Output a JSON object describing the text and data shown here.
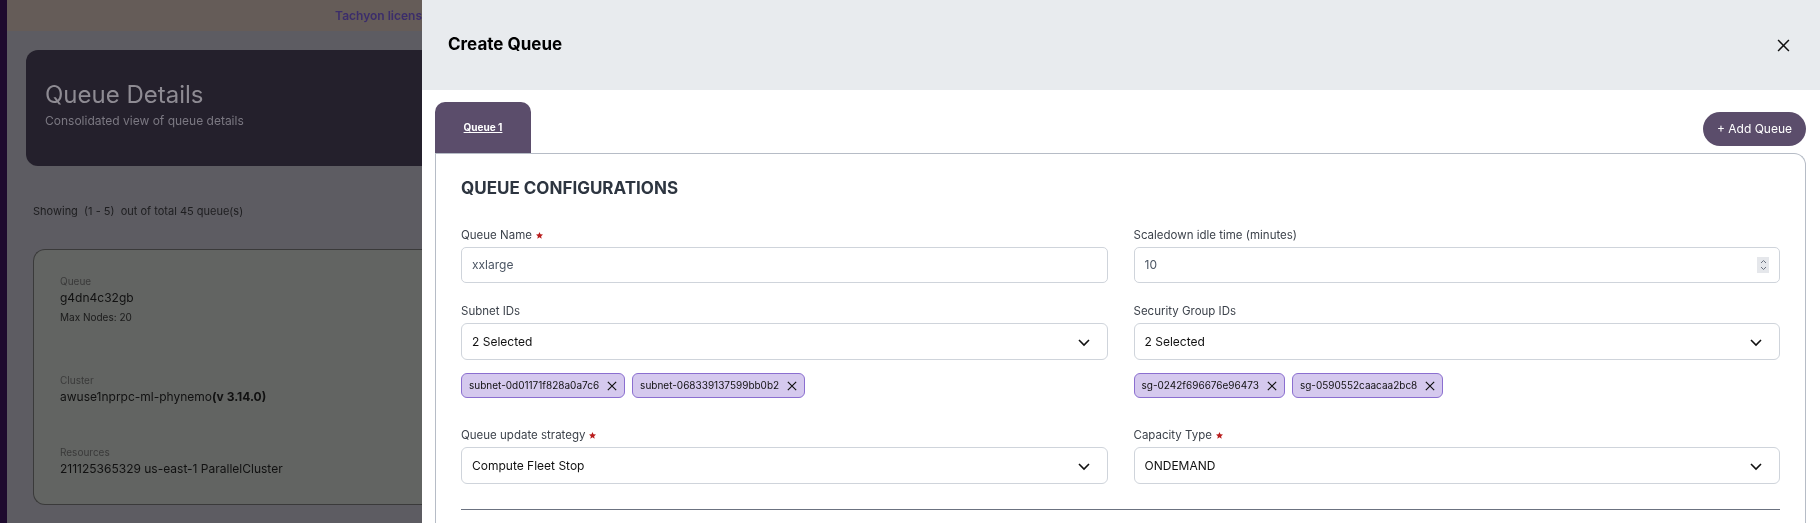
{
  "background_page": {
    "banner": "Tachyon licens",
    "header": {
      "title": "Queue Details",
      "subtitle": "Consolidated view of queue details"
    },
    "showing": "Showing  (1 - 5)  out of total 45 queue(s)",
    "queue_card": [
      {
        "label": "Queue",
        "value": "g4dn4c32gb",
        "note": "Max Nodes: 20"
      },
      {
        "label": "Cluster",
        "value": "awuse1nprpc-ml-phynemo**(v 3.14.0)**"
      },
      {
        "label": "Resources",
        "value": "211125365329 us-east-1 ParallelCluster"
      }
    ]
  },
  "drawer": {
    "title": "Create Queue",
    "tabs": [
      {
        "label": "Queue 1",
        "selected": true
      }
    ],
    "add_button": "+ Add Queue",
    "section_title": "QUEUE CONFIGURATIONS",
    "fields": [
      {
        "kind": "text",
        "label": "Queue Name",
        "required": true,
        "value": "xxlarge"
      },
      {
        "kind": "number",
        "label": "Scaledown idle time (minutes)",
        "required": false,
        "value": "10"
      },
      {
        "kind": "multiselect",
        "label": "Subnet IDs",
        "required": false,
        "value": "2 Selected",
        "chips": [
          "subnet-0d01171f828a0a7c6",
          "subnet-068339137599bb0b2"
        ]
      },
      {
        "kind": "multiselect",
        "label": "Security Group IDs",
        "required": false,
        "value": "2 Selected",
        "chips": [
          "sg-0242f696676e96473",
          "sg-0590552caacaa2bc8"
        ]
      },
      {
        "kind": "select",
        "label": "Queue update strategy",
        "required": true,
        "value": "Compute Fleet Stop"
      },
      {
        "kind": "select",
        "label": "Capacity Type",
        "required": true,
        "value": "ONDEMAND"
      }
    ]
  }
}
